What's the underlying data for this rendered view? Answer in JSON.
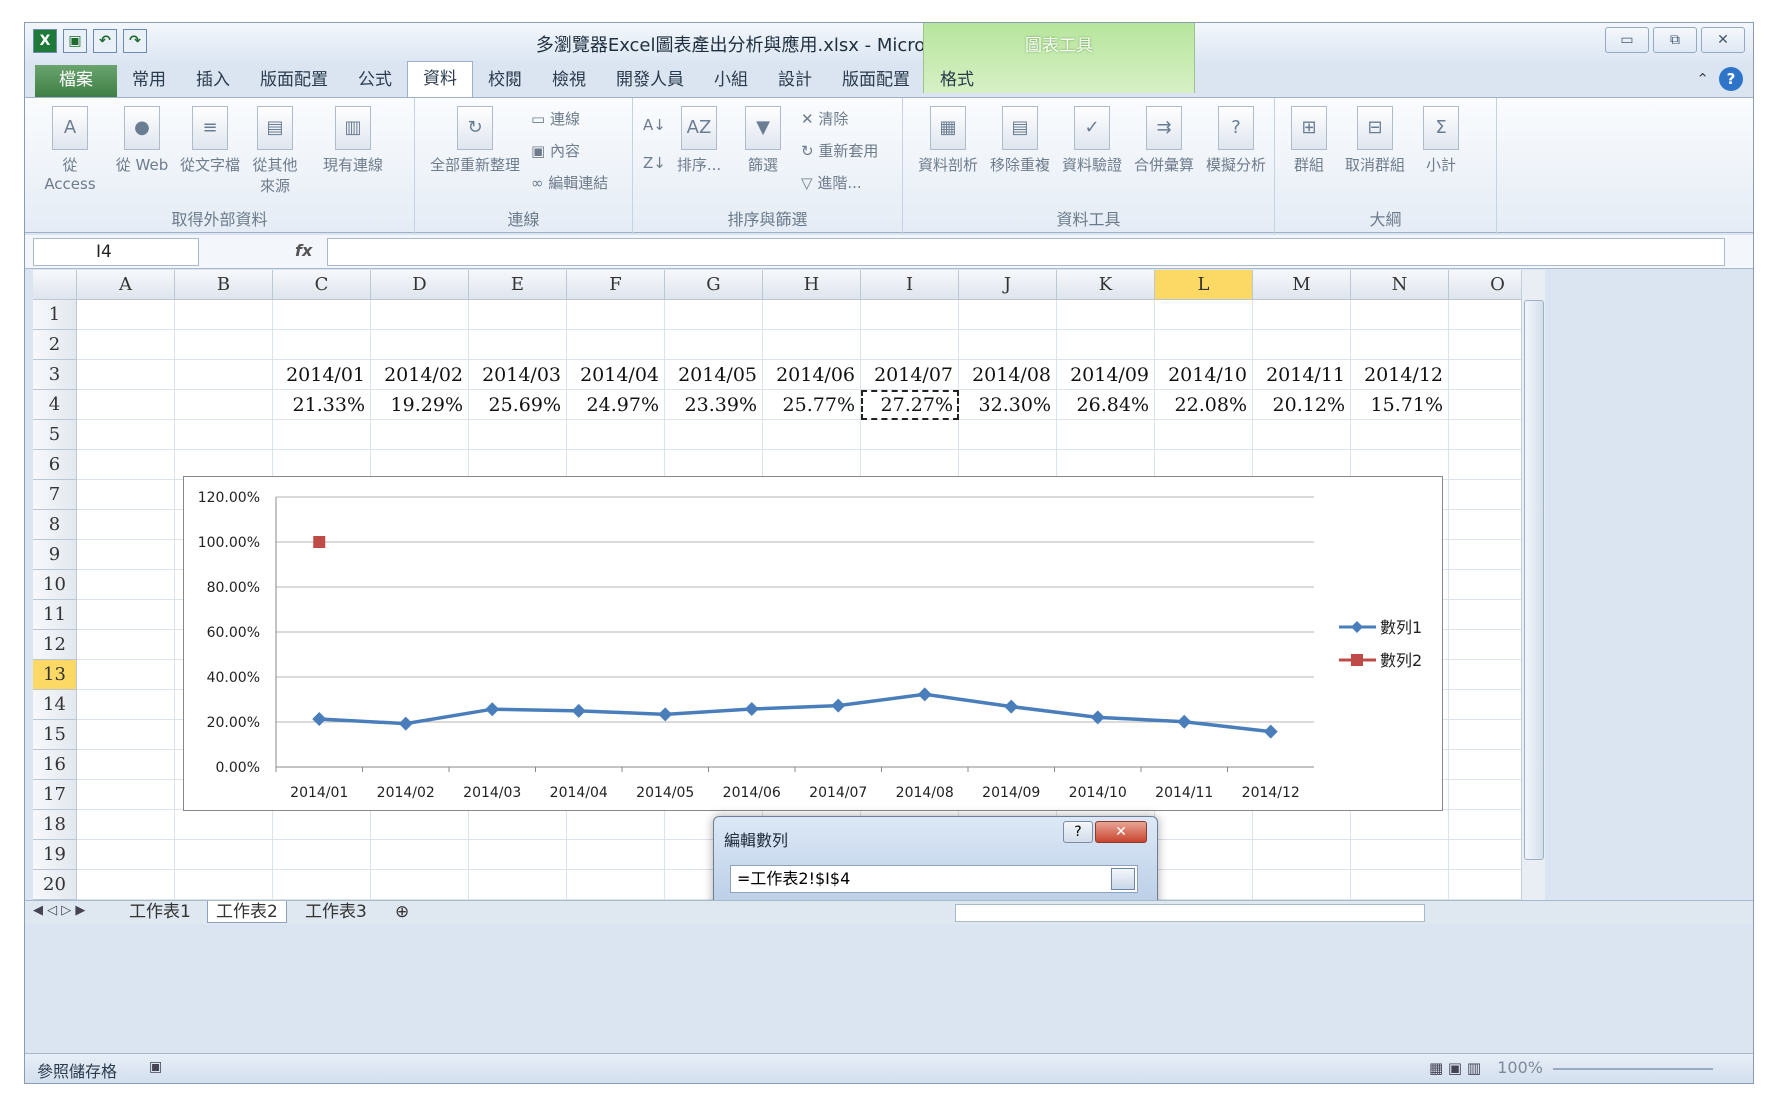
{
  "window": {
    "title": "多瀏覽器Excel圖表產出分析與應用.xlsx - Microsoft Excel",
    "chart_tools_label": "圖表工具",
    "controls": [
      "▭",
      "⧉",
      "✕"
    ]
  },
  "tabs": [
    "檔案",
    "常用",
    "插入",
    "版面配置",
    "公式",
    "資料",
    "校閱",
    "檢視",
    "開發人員",
    "小組",
    "設計",
    "版面配置",
    "格式"
  ],
  "ribbon": {
    "groups": [
      {
        "label": "取得外部資料",
        "buttons": [
          "從 Access",
          "從 Web",
          "從文字檔",
          "從其他\n來源",
          "現有連線"
        ]
      },
      {
        "label": "連線",
        "buttons": [
          "全部重新整理"
        ],
        "small": [
          "連線",
          "內容",
          "編輯連結"
        ]
      },
      {
        "label": "排序與篩選",
        "buttons": [
          "排序...",
          "篩選"
        ],
        "small": [
          "清除",
          "重新套用",
          "進階..."
        ]
      },
      {
        "label": "資料工具",
        "buttons": [
          "資料剖析",
          "移除重複",
          "資料驗證",
          "合併彙算",
          "模擬分析"
        ]
      },
      {
        "label": "大綱",
        "buttons": [
          "群組",
          "取消群組",
          "小計"
        ]
      }
    ]
  },
  "formula_bar": {
    "name_box": "I4",
    "fx": "fx",
    "formula": ""
  },
  "grid": {
    "columns": [
      "A",
      "B",
      "C",
      "D",
      "E",
      "F",
      "G",
      "H",
      "I",
      "J",
      "K",
      "L",
      "M",
      "N",
      "O"
    ],
    "rows": [
      "1",
      "2",
      "3",
      "4",
      "5",
      "6",
      "7",
      "8",
      "9",
      "10",
      "11",
      "12",
      "13",
      "14",
      "15",
      "16",
      "17",
      "18",
      "19",
      "20"
    ],
    "row3": [
      "2014/01",
      "2014/02",
      "2014/03",
      "2014/04",
      "2014/05",
      "2014/06",
      "2014/07",
      "2014/08",
      "2014/09",
      "2014/10",
      "2014/11",
      "2014/12"
    ],
    "row4": [
      "21.33%",
      "19.29%",
      "25.69%",
      "24.97%",
      "23.39%",
      "25.77%",
      "27.27%",
      "32.30%",
      "26.84%",
      "22.08%",
      "20.12%",
      "15.71%"
    ]
  },
  "chart_data": {
    "type": "line",
    "categories": [
      "2014/01",
      "2014/02",
      "2014/03",
      "2014/04",
      "2014/05",
      "2014/06",
      "2014/07",
      "2014/08",
      "2014/09",
      "2014/10",
      "2014/11",
      "2014/12"
    ],
    "ytick_labels": [
      "0.00%",
      "20.00%",
      "40.00%",
      "60.00%",
      "80.00%",
      "100.00%",
      "120.00%"
    ],
    "ylim": [
      0,
      120
    ],
    "grid": true,
    "legend_position": "right",
    "series": [
      {
        "name": "數列1",
        "values": [
          21.33,
          19.29,
          25.69,
          24.97,
          23.39,
          25.77,
          27.27,
          32.3,
          26.84,
          22.08,
          20.12,
          15.71
        ],
        "color": "#4a7ebb",
        "marker": "diamond"
      },
      {
        "name": "數列2",
        "values": [
          100
        ],
        "color": "#be4b48",
        "marker": "square"
      }
    ]
  },
  "dialog": {
    "title": "編輯數列",
    "help": "?",
    "close": "✕",
    "value": "=工作表2!$I$4"
  },
  "sheets": [
    "工作表1",
    "工作表2",
    "工作表3"
  ],
  "status": {
    "mode": "參照儲存格",
    "zoom": "100%"
  }
}
